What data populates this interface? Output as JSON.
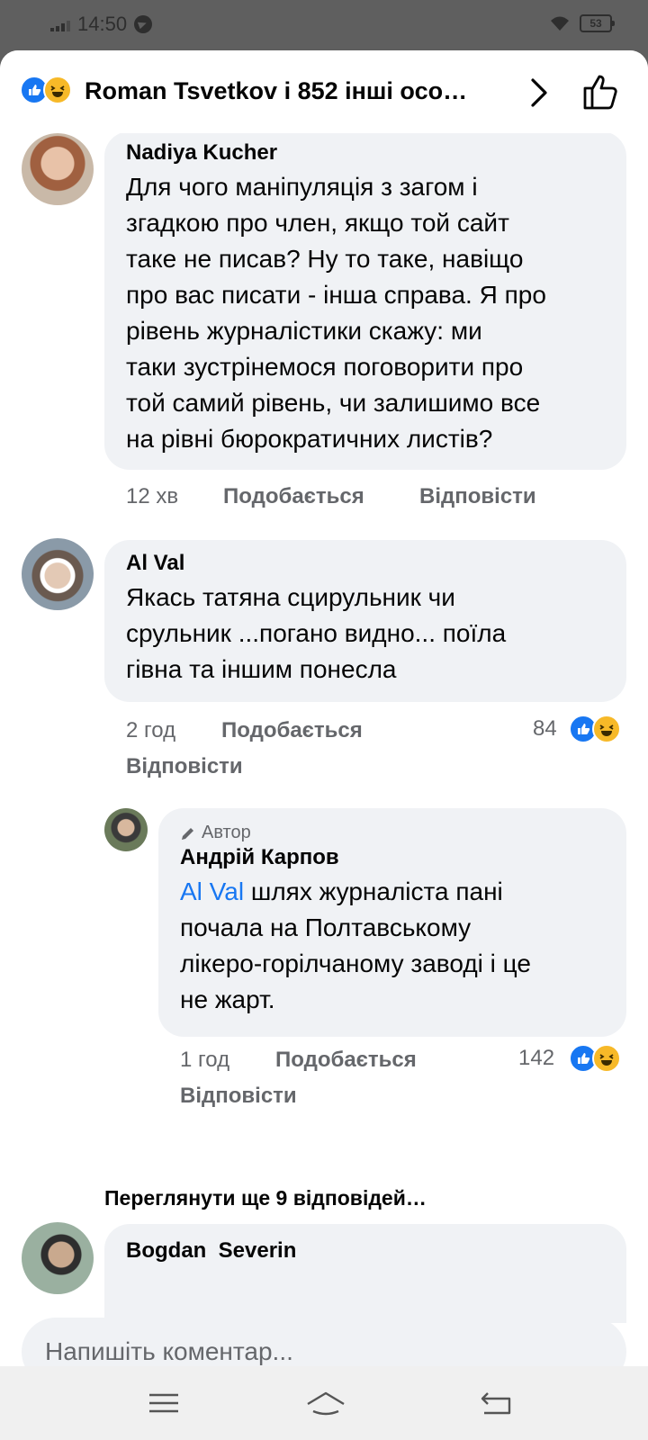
{
  "status_bar": {
    "time": "14:50",
    "battery": "53"
  },
  "header": {
    "title": "Roman Tsvetkov і 852 інші осо…"
  },
  "comments": [
    {
      "author": "Nadiya Kucher",
      "lines": [
        "Для чого маніпуляція з загом і",
        "згадкою про член, якщо той сайт",
        "таке не писав? Ну то таке, навіщо",
        "про вас писати - інша справа. Я про",
        "рівень журналістики скажу: ми",
        "таки зустрінемося поговорити про",
        "той самий рівень, чи залишимо все",
        "на рівні бюрократичних листів?"
      ],
      "time": "12 хв",
      "like": "Подобається",
      "reply": "Відповісти"
    },
    {
      "author": "Al Val",
      "lines": [
        "Якась татяна сцирульник чи",
        "срульник ...погано видно... поїла",
        "гівна та іншим понесла"
      ],
      "time": "2 год",
      "like": "Подобається",
      "reply": "Відповісти",
      "reactions": "84"
    }
  ],
  "reply": {
    "badge": "Автор",
    "author": "Андрій Карпов",
    "mention": "Al Val",
    "line1_rest": " шлях журналіста пані",
    "lines": [
      "почала на Полтавському",
      "лікеро-горілчаному заводі і це",
      "не жарт."
    ],
    "time": "1 год",
    "like": "Подобається",
    "reply": "Відповісти",
    "reactions": "142"
  },
  "more_replies": "Переглянути ще 9 відповідей…",
  "last_comment": {
    "author": "Bogdan  Severin"
  },
  "input": {
    "placeholder": "Напишіть коментар..."
  },
  "icons": [
    "signal-icon",
    "telegram-icon",
    "wifi-icon",
    "battery-icon",
    "like-reaction-icon",
    "haha-reaction-icon",
    "chevron-right-icon",
    "thumbs-up-icon",
    "pencil-icon",
    "menu-icon",
    "home-icon",
    "back-icon"
  ],
  "colors": {
    "accent": "#1877f2",
    "bubble": "#f0f2f5",
    "meta": "#65676b",
    "haha": "#f7b928"
  }
}
